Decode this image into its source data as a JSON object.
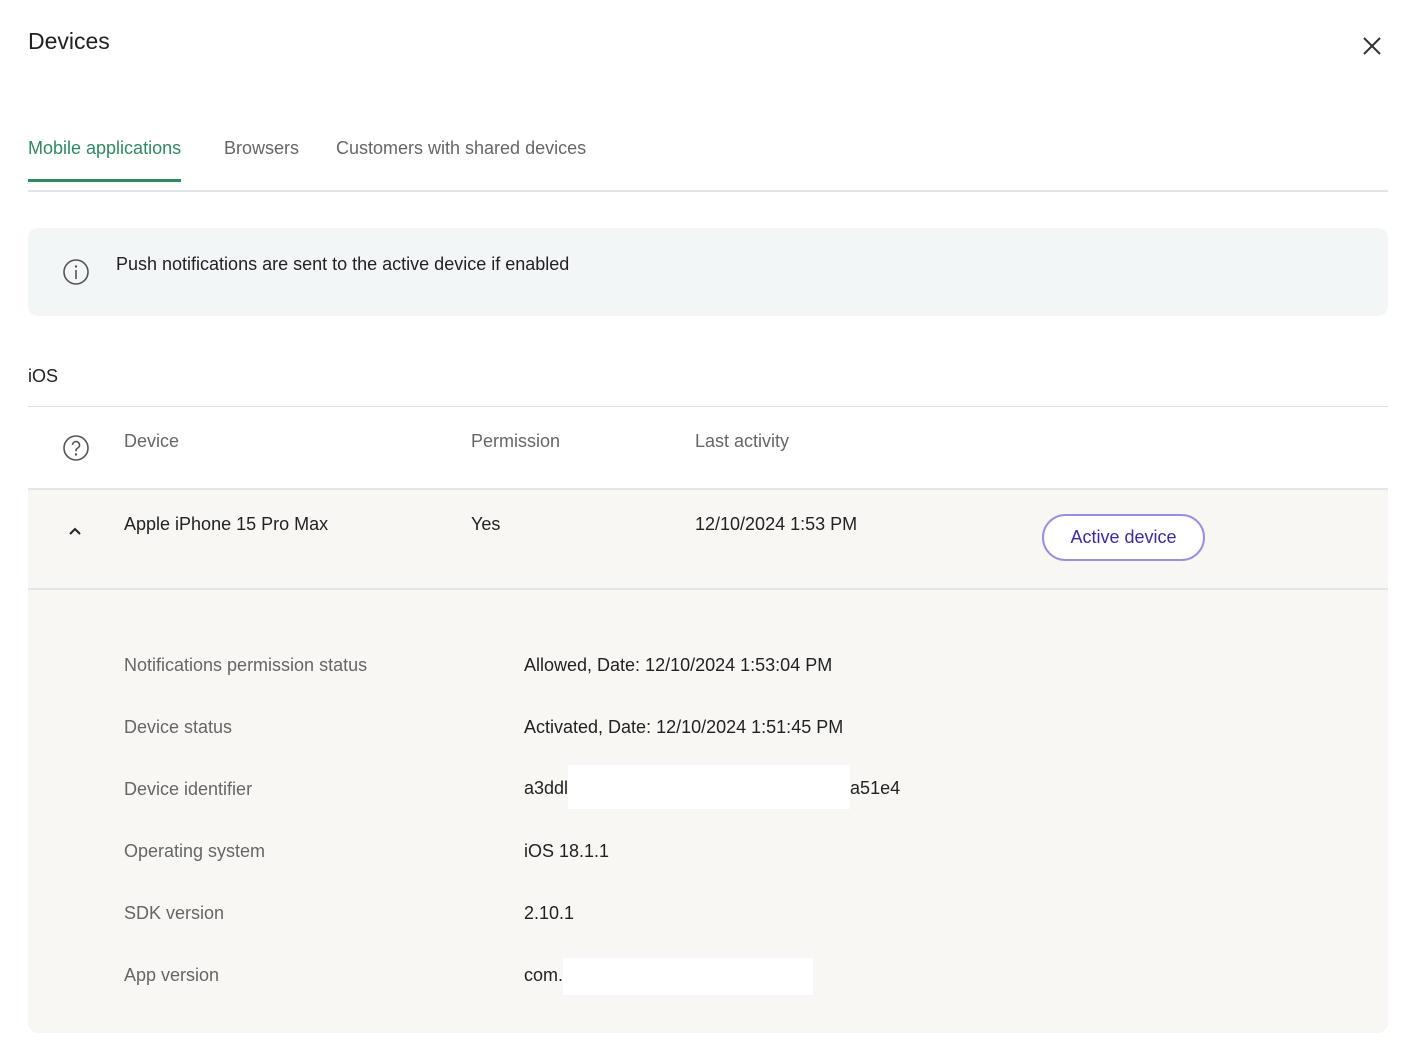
{
  "header": {
    "title": "Devices",
    "close_icon": "close-icon"
  },
  "tabs": [
    {
      "label": "Mobile applications",
      "active": true
    },
    {
      "label": "Browsers",
      "active": false
    },
    {
      "label": "Customers with shared devices",
      "active": false
    }
  ],
  "info": {
    "icon": "info-icon",
    "text": "Push notifications are sent to the active device if enabled"
  },
  "section": {
    "title": "iOS"
  },
  "table": {
    "help_icon": "help-icon",
    "columns": [
      "Device",
      "Permission",
      "Last activity"
    ],
    "rows": [
      {
        "device": "Apple iPhone 15 Pro Max",
        "permission": "Yes",
        "last_activity": "12/10/2024 1:53 PM",
        "button": "Active device",
        "expanded": true
      }
    ]
  },
  "details": [
    {
      "label": "Notifications permission status",
      "value": "Allowed, Date: 12/10/2024 1:53:04 PM"
    },
    {
      "label": "Device status",
      "value": "Activated, Date: 12/10/2024 1:51:45 PM"
    },
    {
      "label": "Device identifier",
      "value_start": "a3ddl",
      "value_end": "a51e4"
    },
    {
      "label": "Operating system",
      "value": "iOS 18.1.1"
    },
    {
      "label": "SDK version",
      "value": "2.10.1"
    },
    {
      "label": "App version",
      "value_start": "com."
    }
  ],
  "colors": {
    "accent": "#2e8a5f",
    "button_text": "#3b2aa8",
    "button_border": "#9b8ee0"
  }
}
